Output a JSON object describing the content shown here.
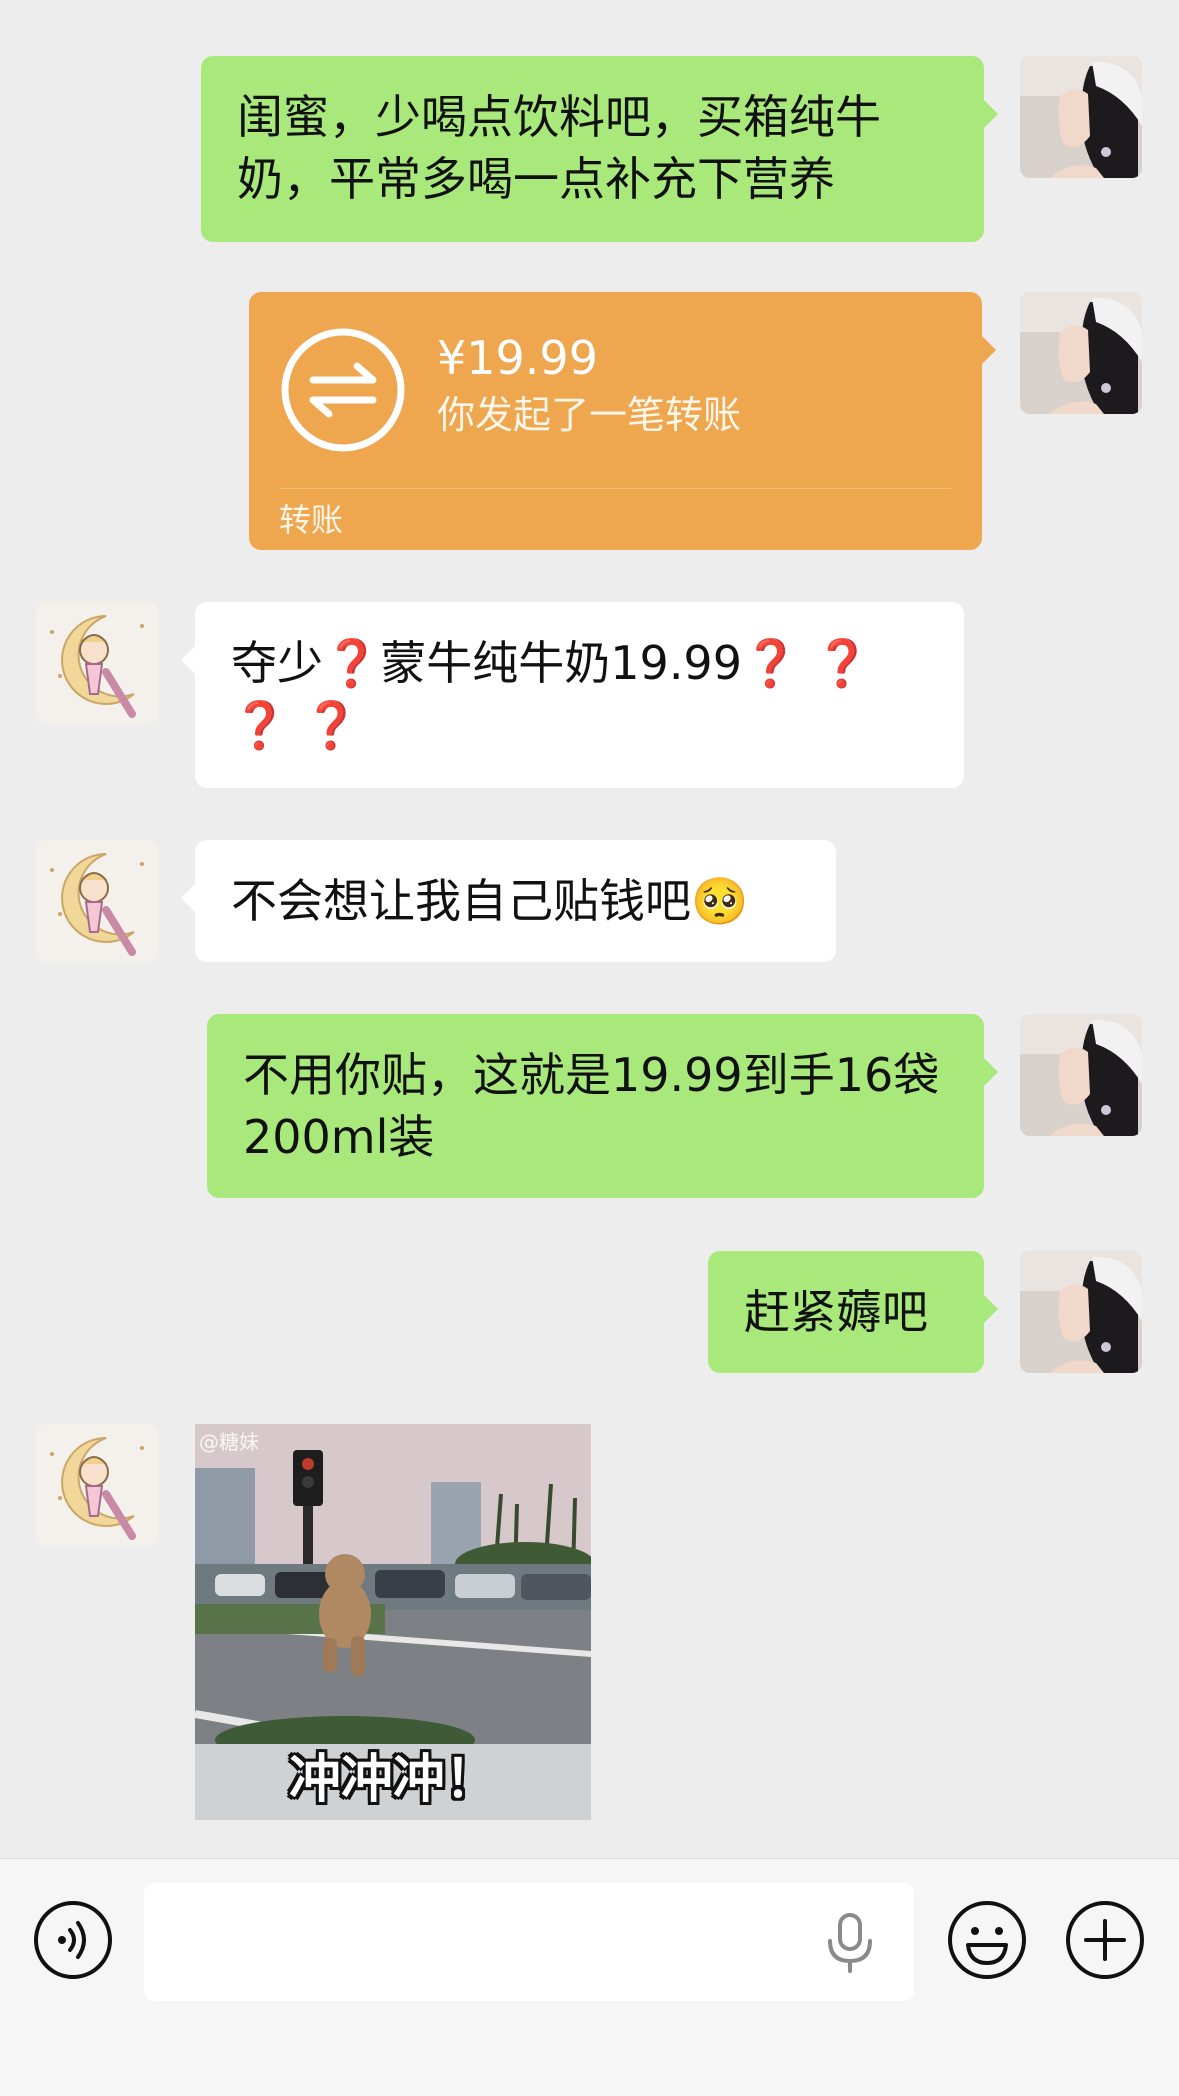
{
  "messages": {
    "m1": {
      "text": "闺蜜，少喝点饮料吧，买箱纯牛奶，平常多喝一点补充下营养"
    },
    "m2": {
      "amount": "¥19.99",
      "desc": "你发起了一笔转账",
      "label": "转账"
    },
    "m3": {
      "text_a": "夺少",
      "q1": "❓",
      "text_b": "蒙牛纯牛奶19.99",
      "q2": "❓",
      "q3": "❓",
      "q4": "❓",
      "q5": "❓"
    },
    "m4": {
      "text": "不会想让我自己贴钱吧",
      "emoji": "🥺"
    },
    "m5": {
      "text": "不用你贴，这就是19.99到手16袋200ml装"
    },
    "m6": {
      "text": "赶紧薅吧"
    },
    "m7": {
      "caption": "冲冲冲！",
      "watermark": "@糖妹"
    }
  },
  "input_bar": {
    "voice_icon": "voice-icon",
    "mic_icon": "microphone-icon",
    "emoji_icon": "emoji-icon",
    "plus_icon": "plus-icon",
    "value": ""
  },
  "colors": {
    "background": "#ededed",
    "my_bubble": "#a9e97c",
    "friend_bubble": "#ffffff",
    "transfer": "#eea64f",
    "question_mark": "#d8261f"
  }
}
